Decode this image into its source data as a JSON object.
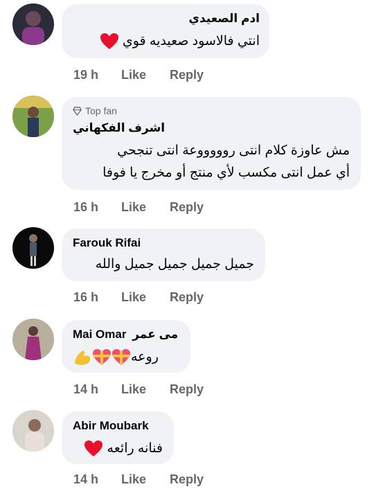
{
  "actions": {
    "like_label": "Like",
    "reply_label": "Reply"
  },
  "comments": [
    {
      "author": "ادم الصعيدي",
      "text": "انتي فالاسود صعيديه قوي",
      "time": "19 h",
      "emoji": "heart-emoji"
    },
    {
      "badge": "Top fan",
      "author": "اشرف الفكهاني",
      "lines": [
        "مش عاوزة كلام انتى روووووعة انتى تنجحي",
        "أي عمل انتى مكسب لأي منتج أو مخرج يا فوفا"
      ],
      "time": "16 h"
    },
    {
      "author": "Farouk Rifai",
      "text": "جميل جميل جميل جميل والله",
      "time": "16 h"
    },
    {
      "author": "Mai Omar",
      "author_suffix": "مى عمر",
      "text": "روعه",
      "time": "14 h",
      "emojis": [
        "heart-gift-emoji",
        "heart-gift-emoji",
        "flexed-biceps-emoji"
      ]
    },
    {
      "author": "Abir Moubark",
      "text": "فنانه رائعه",
      "time": "14 h",
      "emoji": "heart-emoji"
    }
  ],
  "colors": {
    "bubble": "#f0f2f5",
    "meta": "#65676b",
    "heart": "#e8112d"
  }
}
